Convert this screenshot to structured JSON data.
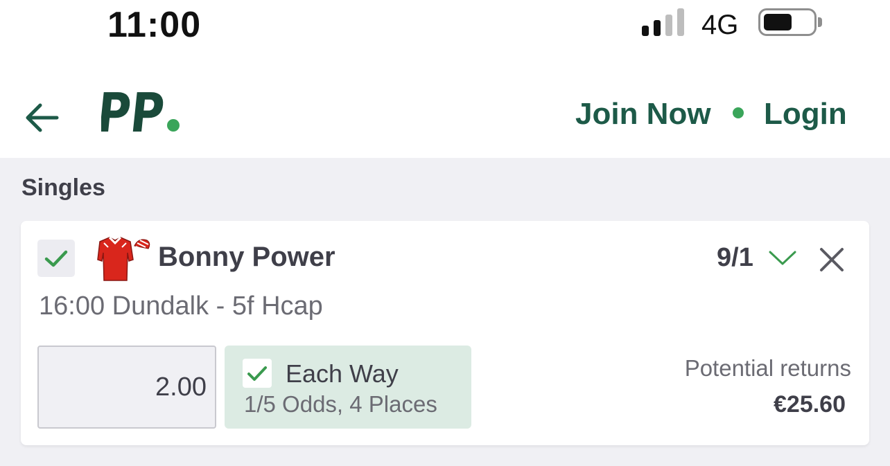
{
  "status_bar": {
    "time": "11:00",
    "network": "4G",
    "signal_bars_filled": 2,
    "signal_bars_total": 4,
    "battery_level": 0.55
  },
  "header": {
    "logo_text": "PP.",
    "join_label": "Join Now",
    "login_label": "Login",
    "back_icon": "arrow-left-icon"
  },
  "colors": {
    "brand_green": "#1d5a48",
    "accent_dot": "#3aa55a",
    "check_green": "#3a9a4e",
    "each_way_bg": "#dcebe3"
  },
  "betslip": {
    "section_title": "Singles",
    "selection": {
      "selected": true,
      "runner_name": "Bonny Power",
      "silks_icon": "jockey-silks-icon",
      "odds": "9/1",
      "race": "16:00 Dundalk - 5f Hcap",
      "stake": "2.00",
      "each_way": {
        "checked": true,
        "label": "Each Way",
        "terms": "1/5 Odds, 4 Places"
      },
      "potential_returns_label": "Potential returns",
      "potential_returns_value": "€25.60"
    }
  }
}
